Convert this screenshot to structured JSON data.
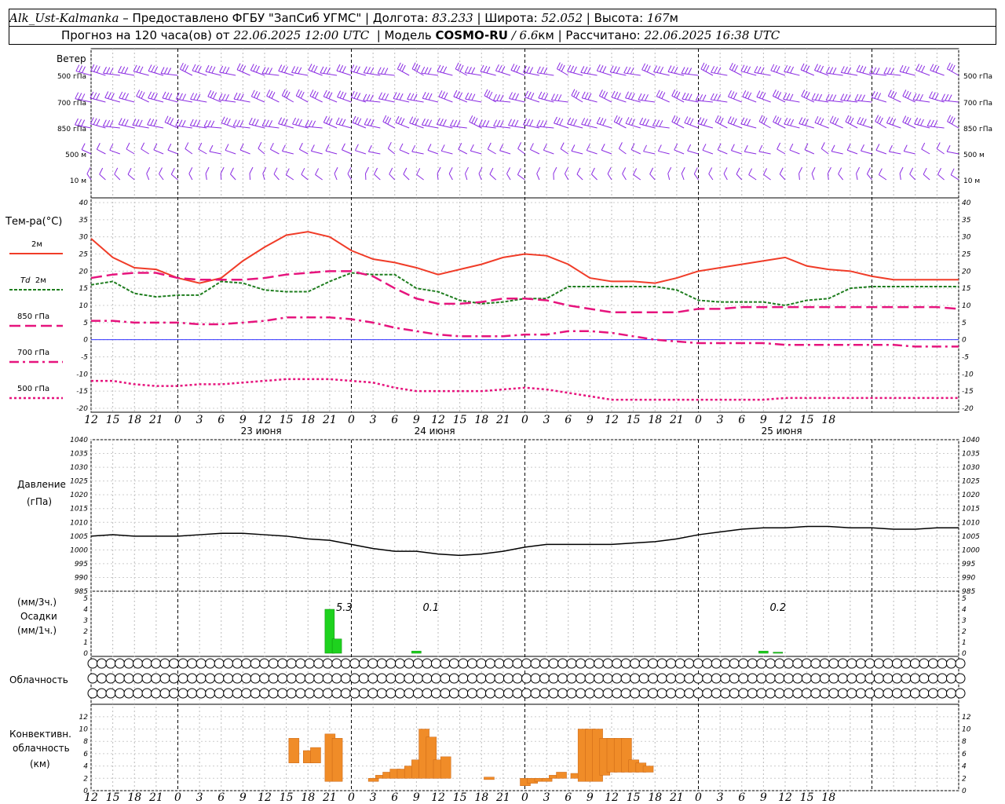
{
  "header": {
    "station": "Alk_Ust-Kalmanka",
    "provider": " – Предоставлено ФГБУ \"ЗапСиб УГМС\" | Долгота: ",
    "lon": "83.233",
    "lat_label": " | Широта: ",
    "lat": "52.052",
    "alt_label": " | Высота: ",
    "alt": "167",
    "alt_unit": "м",
    "forecast_label": "Прогноз на 120 часа(ов) от ",
    "init": "22.06.2025 12:00 UTC",
    "model_label": "  | Модель ",
    "model": "COSMO-RU",
    "res": " / 6.6",
    "res_unit": "км",
    "calc_label": " | Рассчитано: ",
    "calc": "22.06.2025 16:38 UTC"
  },
  "labels": {
    "wind": "Ветер",
    "levels": [
      "500 гПа",
      "700 гПа",
      "850 гПа",
      "500 м",
      "10 м"
    ],
    "levels_right": [
      "500 гПа",
      "700 гПа",
      "850 гПа",
      "500 м",
      "10 м"
    ],
    "temp": "Тем-ра(°С)",
    "t2m": "2м",
    "td": "Td",
    "td_unit": "2м",
    "t850": "850 гПа",
    "t700": "700 гПа",
    "t500": "500 гПа",
    "pres1": "Давление",
    "pres2": "(гПа)",
    "prec1": "(мм/3ч.)",
    "prec2": "Осадки",
    "prec3": "(мм/1ч.)",
    "cloud": "Облачность",
    "conv1": "Конвективн.",
    "conv2": "облачность",
    "conv3": "(км)"
  },
  "colors": {
    "t2m": "#f03c28",
    "td": "#1e7d1e",
    "t850": "#e6147d",
    "t700": "#e6147d",
    "t500": "#e6147d",
    "wind": "#8a2be2",
    "precip": "#1ed21e",
    "conv": "#f08c28",
    "pressure": "#000000",
    "zero": "#3232ff"
  },
  "chart_data": [
    {
      "type": "line",
      "title": "Температура",
      "ylabel": "Тем-ра(°С)",
      "xlabel": "",
      "x_hours": [
        0,
        3,
        6,
        9,
        12,
        15,
        18,
        21,
        24,
        27,
        30,
        33,
        36,
        39,
        42,
        45,
        48,
        51,
        54,
        57,
        60,
        63,
        66,
        69,
        72,
        75,
        78,
        81,
        84,
        87,
        90,
        93,
        96,
        99,
        102,
        105,
        108,
        111,
        114,
        117,
        120
      ],
      "x_ticks": [
        "12",
        "15",
        "18",
        "21",
        "0",
        "3",
        "6",
        "9",
        "12",
        "15",
        "18",
        "21",
        "0",
        "3",
        "6",
        "9",
        "12",
        "15",
        "18",
        "21",
        "0",
        "3",
        "6",
        "9",
        "12",
        "15",
        "18",
        "21",
        "0",
        "3",
        "6",
        "9",
        "12",
        "15",
        "18"
      ],
      "date_labels": [
        "23 июня",
        "24 июня",
        "25 июня"
      ],
      "ylim": [
        -20,
        40
      ],
      "yticks": [
        40,
        35,
        30,
        25,
        20,
        15,
        10,
        5,
        0,
        -5,
        -10,
        -15,
        -20
      ],
      "series": [
        {
          "name": "2м",
          "values": [
            29.5,
            24,
            21,
            20.5,
            18,
            16.5,
            18,
            23,
            27,
            30.5,
            31.5,
            30,
            26,
            23.5,
            22.5,
            21,
            19,
            20.5,
            22,
            24,
            25,
            24.5,
            22,
            18,
            17,
            17,
            16.5,
            18,
            20,
            21,
            22,
            23,
            24,
            21.5,
            20.5,
            20,
            18.5,
            17.5,
            17.5,
            17.5,
            17.5
          ]
        },
        {
          "name": "Td",
          "values": [
            16,
            17,
            13.5,
            12.5,
            13,
            13,
            17,
            16.5,
            14.5,
            14,
            14,
            17,
            19.5,
            19,
            19,
            15,
            14,
            11.5,
            10.5,
            11,
            12,
            12,
            15.5,
            15.5,
            15.5,
            15.5,
            15.5,
            14.5,
            11.5,
            11,
            11,
            11,
            10,
            11.5,
            12,
            15,
            15.5,
            15.5,
            15.5,
            15.5,
            15.5
          ]
        },
        {
          "name": "850 гПа",
          "values": [
            18,
            19,
            19.5,
            19.5,
            18,
            17.5,
            17.5,
            17.5,
            18,
            19,
            19.5,
            20,
            20,
            18.5,
            15,
            12,
            10.5,
            10.5,
            11,
            12,
            12,
            11.5,
            10,
            9,
            8,
            8,
            8,
            8,
            9,
            9,
            9.5,
            9.5,
            9.5,
            9.5,
            9.5,
            9.5,
            9.5,
            9.5,
            9.5,
            9.5,
            9
          ]
        },
        {
          "name": "700 гПа",
          "values": [
            5.5,
            5.5,
            5,
            5,
            5,
            4.5,
            4.5,
            5,
            5.5,
            6.5,
            6.5,
            6.5,
            6,
            5,
            3.5,
            2.5,
            1.5,
            1,
            1,
            1,
            1.5,
            1.5,
            2.5,
            2.5,
            2,
            1,
            0,
            -0.5,
            -1,
            -1,
            -1,
            -1,
            -1.5,
            -1.5,
            -1.5,
            -1.5,
            -1.5,
            -1.5,
            -2,
            -2,
            -2
          ]
        },
        {
          "name": "500 гПа",
          "values": [
            -12,
            -12,
            -13,
            -13.5,
            -13.5,
            -13,
            -13,
            -12.5,
            -12,
            -11.5,
            -11.5,
            -11.5,
            -12,
            -12.5,
            -14,
            -15,
            -15,
            -15,
            -15,
            -14.5,
            -14,
            -14.5,
            -15.5,
            -16.5,
            -17.5,
            -17.5,
            -17.5,
            -17.5,
            -17.5,
            -17.5,
            -17.5,
            -17.5,
            -17,
            -17,
            -17,
            -17,
            -17,
            -17,
            -17,
            -17,
            -17
          ]
        }
      ]
    },
    {
      "type": "line",
      "title": "Давление",
      "ylabel": "Давление (гПа)",
      "ylim": [
        985,
        1040
      ],
      "yticks": [
        1040,
        1035,
        1030,
        1025,
        1020,
        1015,
        1010,
        1005,
        1000,
        995,
        990,
        985
      ],
      "series": [
        {
          "name": "Давление",
          "values": [
            1005,
            1005.5,
            1005,
            1005,
            1005,
            1005.5,
            1006,
            1006,
            1005.5,
            1005,
            1004,
            1003.5,
            1002,
            1000.5,
            999.5,
            999.5,
            998.5,
            998,
            998.5,
            999.5,
            1001,
            1002,
            1002,
            1002,
            1002,
            1002.5,
            1003,
            1004,
            1005.5,
            1006.5,
            1007.5,
            1008,
            1008,
            1008.5,
            1008.5,
            1008,
            1008,
            1007.5,
            1007.5,
            1008,
            1008
          ]
        }
      ]
    },
    {
      "type": "bar",
      "title": "Осадки",
      "ylabel": "Осадки (мм/3ч.) (мм/1ч.)",
      "ylim": [
        0,
        5
      ],
      "yticks": [
        5,
        4,
        3,
        2,
        1,
        0
      ],
      "bars": [
        {
          "hour": 33,
          "value": 4
        },
        {
          "hour": 34,
          "value": 1.3
        },
        {
          "hour": 45,
          "value": 0.2
        },
        {
          "hour": 93,
          "value": 0.2
        },
        {
          "hour": 95,
          "value": 0.1
        }
      ],
      "totals": [
        {
          "hour": 35,
          "label": "5.3"
        },
        {
          "hour": 47,
          "label": "0.1"
        },
        {
          "hour": 95,
          "label": "0.2"
        }
      ]
    },
    {
      "type": "bar",
      "title": "Конвективн. облачность",
      "ylabel": "Конвективн. облачность (км)",
      "ylim": [
        0,
        13
      ],
      "yticks": [
        12,
        10,
        8,
        6,
        4,
        2,
        0
      ],
      "bars": [
        {
          "hour": 28,
          "base": 4.5,
          "top": 8.5
        },
        {
          "hour": 30,
          "base": 4.5,
          "top": 6.5
        },
        {
          "hour": 31,
          "base": 4.5,
          "top": 7.0
        },
        {
          "hour": 33,
          "base": 1.5,
          "top": 9.2
        },
        {
          "hour": 34,
          "base": 1.5,
          "top": 8.5
        },
        {
          "hour": 39,
          "base": 1.5,
          "top": 2.0
        },
        {
          "hour": 40,
          "base": 2.0,
          "top": 2.5
        },
        {
          "hour": 41,
          "base": 2.0,
          "top": 3.0
        },
        {
          "hour": 42,
          "base": 2.0,
          "top": 3.5
        },
        {
          "hour": 43,
          "base": 2.0,
          "top": 3.5
        },
        {
          "hour": 44,
          "base": 2.0,
          "top": 4.0
        },
        {
          "hour": 45,
          "base": 2.0,
          "top": 5.0
        },
        {
          "hour": 46,
          "base": 2.0,
          "top": 10.0
        },
        {
          "hour": 47,
          "base": 2.0,
          "top": 8.7
        },
        {
          "hour": 48,
          "base": 2.0,
          "top": 5.0
        },
        {
          "hour": 49,
          "base": 2.0,
          "top": 5.5
        },
        {
          "hour": 55,
          "base": 1.8,
          "top": 2.2
        },
        {
          "hour": 60,
          "base": 0.8,
          "top": 2.0
        },
        {
          "hour": 61,
          "base": 1.2,
          "top": 2.0
        },
        {
          "hour": 62,
          "base": 1.5,
          "top": 2.0
        },
        {
          "hour": 63,
          "base": 1.5,
          "top": 2.0
        },
        {
          "hour": 64,
          "base": 2.0,
          "top": 2.5
        },
        {
          "hour": 65,
          "base": 2.0,
          "top": 3.0
        },
        {
          "hour": 67,
          "base": 2.0,
          "top": 2.8
        },
        {
          "hour": 68,
          "base": 1.5,
          "top": 10.0
        },
        {
          "hour": 69,
          "base": 1.5,
          "top": 10.0
        },
        {
          "hour": 70,
          "base": 1.5,
          "top": 10.0
        },
        {
          "hour": 71,
          "base": 2.5,
          "top": 8.5
        },
        {
          "hour": 72,
          "base": 3.0,
          "top": 8.5
        },
        {
          "hour": 73,
          "base": 3.0,
          "top": 8.5
        },
        {
          "hour": 74,
          "base": 3.0,
          "top": 8.5
        },
        {
          "hour": 75,
          "base": 3.0,
          "top": 5.0
        },
        {
          "hour": 76,
          "base": 3.0,
          "top": 4.5
        },
        {
          "hour": 77,
          "base": 3.0,
          "top": 4.0
        }
      ]
    }
  ]
}
